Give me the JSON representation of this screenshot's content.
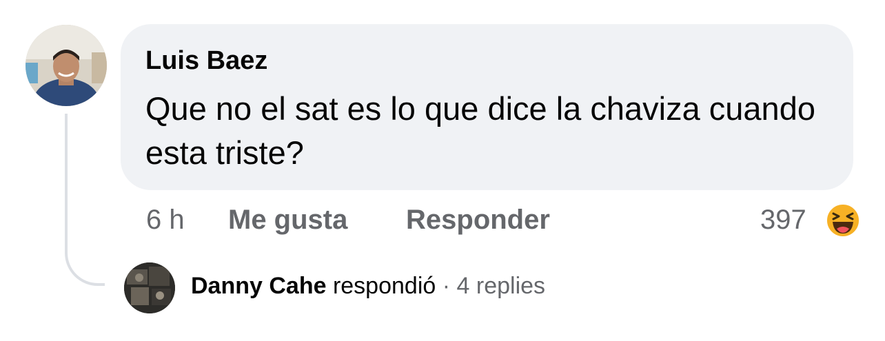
{
  "comment": {
    "author": "Luis Baez",
    "text": "Que no el sat es lo que dice la chaviza cuando esta triste?",
    "time": "6 h",
    "like_label": "Me gusta",
    "reply_label": "Responder",
    "reaction_count": "397",
    "reaction_icon": "haha-reaction-icon"
  },
  "reply_summary": {
    "name": "Danny Cahe",
    "verb": "respondió",
    "separator": "·",
    "count_text": "4 replies"
  },
  "colors": {
    "bubble": "#f0f2f5",
    "meta_text": "#65676b",
    "primary_text": "#050505",
    "haha_yellow": "#f7b125"
  }
}
